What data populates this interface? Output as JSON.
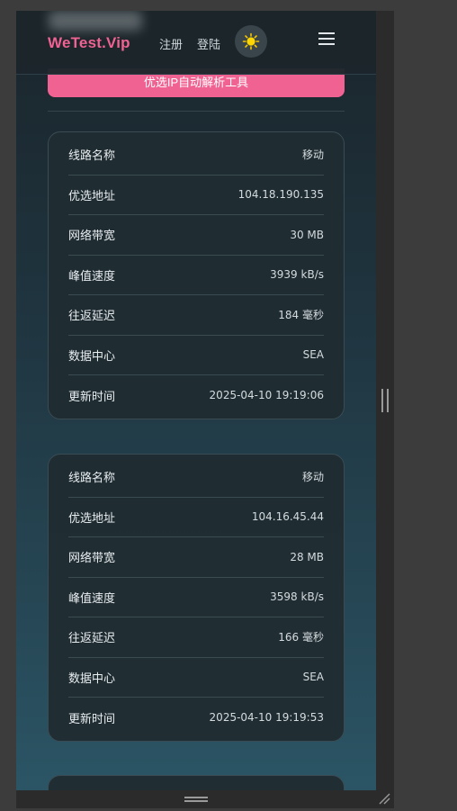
{
  "navbar": {
    "brand": "WeTest.Vip",
    "register": "注册",
    "login": "登陆",
    "theme_icon": "sun-icon",
    "menu_icon": "hamburger-icon"
  },
  "top_button": {
    "label": "优选IP自动解析工具"
  },
  "cards": [
    {
      "rows": [
        {
          "label": "线路名称",
          "value": "移动"
        },
        {
          "label": "优选地址",
          "value": "104.18.190.135"
        },
        {
          "label": "网络带宽",
          "value": "30 MB"
        },
        {
          "label": "峰值速度",
          "value": "3939 kB/s"
        },
        {
          "label": "往返延迟",
          "value": "184 毫秒"
        },
        {
          "label": "数据中心",
          "value": "SEA"
        },
        {
          "label": "更新时间",
          "value": "2025-04-10 19:19:06"
        }
      ]
    },
    {
      "rows": [
        {
          "label": "线路名称",
          "value": "移动"
        },
        {
          "label": "优选地址",
          "value": "104.16.45.44"
        },
        {
          "label": "网络带宽",
          "value": "28 MB"
        },
        {
          "label": "峰值速度",
          "value": "3598 kB/s"
        },
        {
          "label": "往返延迟",
          "value": "166 毫秒"
        },
        {
          "label": "数据中心",
          "value": "SEA"
        },
        {
          "label": "更新时间",
          "value": "2025-04-10 19:19:53"
        }
      ]
    }
  ],
  "colors": {
    "accent": "#f06292",
    "card_bg": "#202c32",
    "page_bg": "#1f3540"
  }
}
